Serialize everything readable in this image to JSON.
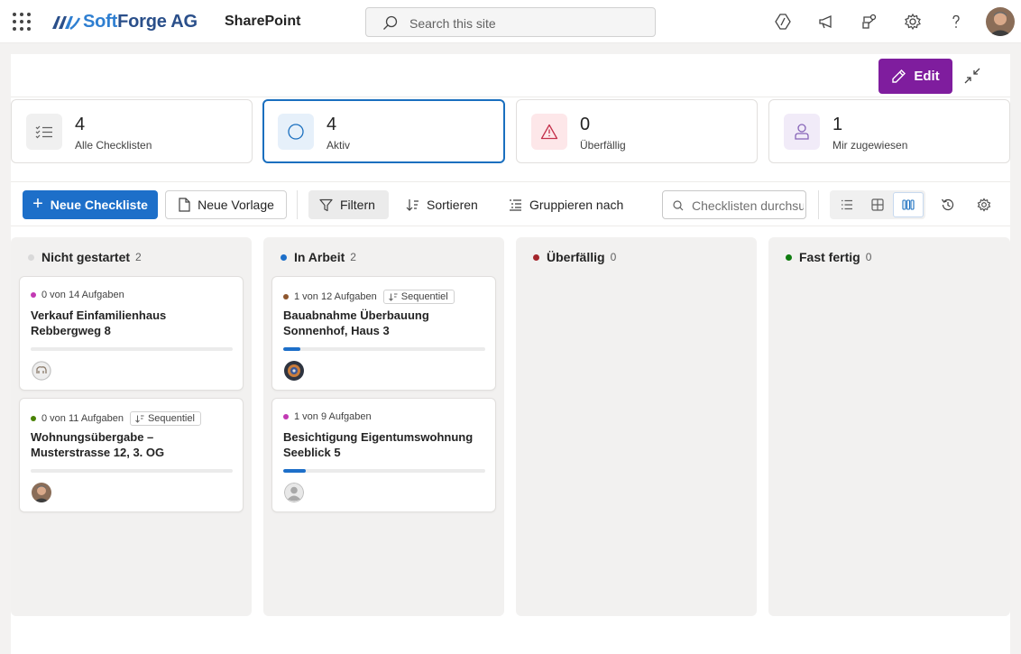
{
  "header": {
    "brand_name": "SoftForge AG",
    "brand_first": "Soft",
    "brand_second": "Forge AG",
    "app_name": "SharePoint",
    "search_placeholder": "Search this site",
    "icons": [
      "copilot-icon",
      "megaphone-icon",
      "share-icon",
      "settings-icon",
      "help-icon"
    ]
  },
  "panel": {
    "edit_label": "Edit"
  },
  "stats": [
    {
      "value": "4",
      "label": "Alle Checklisten",
      "icon": "checklist-icon",
      "accent": "#616161"
    },
    {
      "value": "4",
      "label": "Aktiv",
      "icon": "circle-icon",
      "accent": "#1a6fbf"
    },
    {
      "value": "0",
      "label": "Überfällig",
      "icon": "warning-icon",
      "accent": "#c4314b"
    },
    {
      "value": "1",
      "label": "Mir zugewiesen",
      "icon": "person-icon",
      "accent": "#8764b8"
    }
  ],
  "toolbar": {
    "new_checklist": "Neue Checkliste",
    "new_template": "Neue Vorlage",
    "filter": "Filtern",
    "sort": "Sortieren",
    "group_by": "Gruppieren nach",
    "search_placeholder": "Checklisten durchsuchen",
    "views": [
      "list-view-icon",
      "grid-view-icon",
      "board-view-icon"
    ],
    "active_view": "board-view-icon"
  },
  "columns": [
    {
      "title": "Nicht gestartet",
      "count": "2",
      "color": "#d9d9d9",
      "cards": [
        {
          "meta": "0 von 14 Aufgaben",
          "dot": "#c239b3",
          "sequential": "",
          "title": "Verkauf Einfamilienhaus Rebbergweg 8",
          "progress": 0
        },
        {
          "meta": "0 von 11 Aufgaben",
          "dot": "#498205",
          "sequential": "Sequentiel",
          "title": "Wohnungsübergabe – Musterstrasse 12, 3. OG",
          "progress": 0
        }
      ]
    },
    {
      "title": "In Arbeit",
      "count": "2",
      "color": "#1d6fc9",
      "cards": [
        {
          "meta": "1 von 12 Aufgaben",
          "dot": "#8e562e",
          "sequential": "Sequentiel",
          "title": "Bauabnahme Überbauung Sonnenhof, Haus 3",
          "progress": 0.083
        },
        {
          "meta": "1 von 9 Aufgaben",
          "dot": "#c239b3",
          "sequential": "",
          "title": "Besichtigung Eigentumswohnung Seeblick 5",
          "progress": 0.111
        }
      ]
    },
    {
      "title": "Überfällig",
      "count": "0",
      "color": "#a4262c",
      "cards": []
    },
    {
      "title": "Fast fertig",
      "count": "0",
      "color": "#107c10",
      "cards": []
    }
  ]
}
